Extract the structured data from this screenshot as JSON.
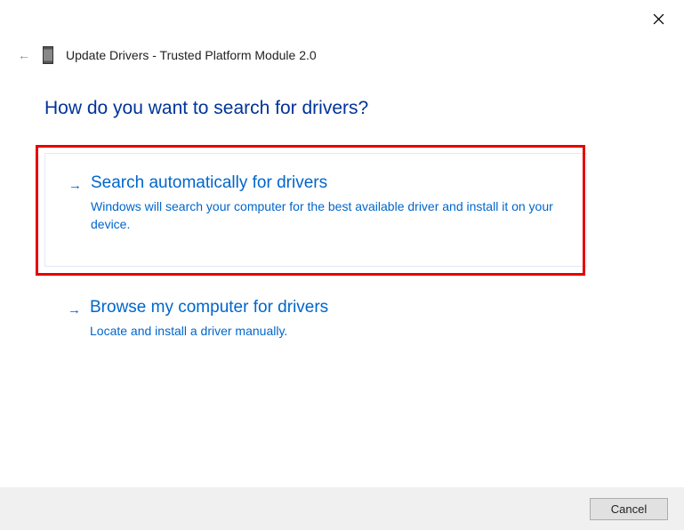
{
  "window": {
    "title": "Update Drivers - Trusted Platform Module 2.0"
  },
  "heading": "How do you want to search for drivers?",
  "options": [
    {
      "title": "Search automatically for drivers",
      "description": "Windows will search your computer for the best available driver and install it on your device."
    },
    {
      "title": "Browse my computer for drivers",
      "description": "Locate and install a driver manually."
    }
  ],
  "buttons": {
    "cancel": "Cancel"
  }
}
